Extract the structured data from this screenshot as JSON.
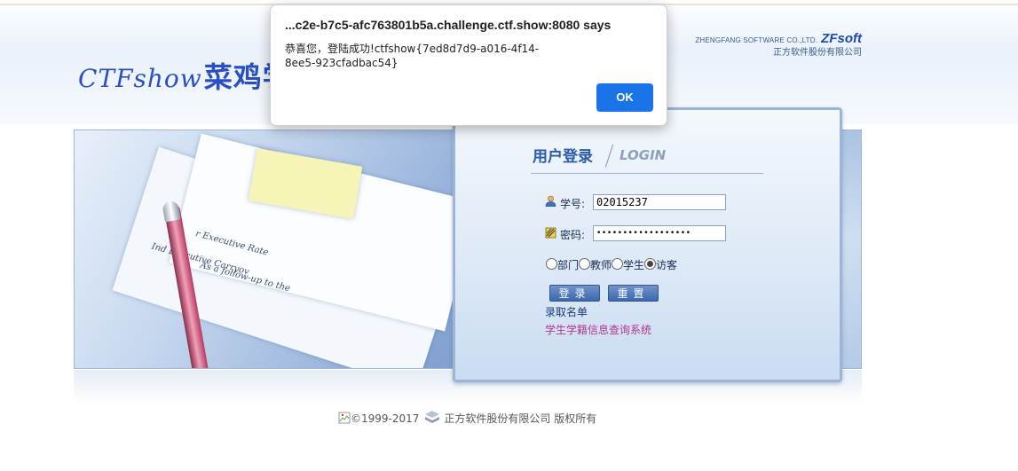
{
  "header": {
    "logo_en": "CTFshow",
    "logo_cn": "菜鸡学",
    "brand_en": "ZHENGFANG SOFTWARE CO.,LTD.",
    "brand_mark": "ZFsoft",
    "brand_cn": "正方软件股份有限公司"
  },
  "photo_text": {
    "line1": "r Executive Rate",
    "line2": "Ind  Executive Carryov",
    "line3": "As a follow-up to the"
  },
  "login": {
    "title_cn": "用户登录",
    "title_en": "LOGIN",
    "student_id_label": "学号:",
    "student_id_value": "02015237",
    "password_label": "密码:",
    "password_value": "••••••••••••••••••",
    "roles": [
      {
        "label": "部门",
        "selected": false
      },
      {
        "label": "教师",
        "selected": false
      },
      {
        "label": "学生",
        "selected": false
      },
      {
        "label": "访客",
        "selected": true
      }
    ],
    "login_button": "登录",
    "reset_button": "重置",
    "link_admission_list": "录取名单",
    "link_student_records": "学生学籍信息查询系统"
  },
  "footer": {
    "copyright": "©1999-2017",
    "company": "正方软件股份有限公司 版权所有"
  },
  "alert": {
    "title": "...c2e-b7c5-afc763801b5a.challenge.ctf.show:8080 says",
    "message": "恭喜您，登陆成功!ctfshow{7ed8d7d9-a016-4f14-8ee5-923cfadbac54}",
    "ok_label": "OK"
  },
  "colors": {
    "accent_blue": "#1a73e8",
    "link_blue": "#1c3a78",
    "link_magenta": "#b0368c",
    "panel_title": "#2a5ba8"
  },
  "icons": [
    "user-icon",
    "key-icon",
    "broken-image-icon",
    "zfsoft-logo-icon"
  ]
}
